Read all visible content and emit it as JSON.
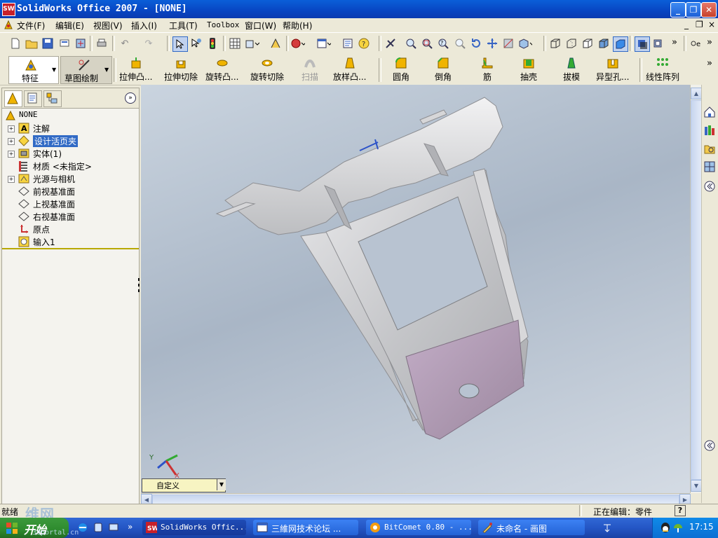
{
  "window": {
    "title": "SolidWorks Office 2007 - [NONE]",
    "app_icon": "SW",
    "min_symbol": "_",
    "max_symbol": "❐",
    "close_symbol": "✕"
  },
  "menubar": {
    "items": [
      "文件(F)",
      "编辑(E)",
      "视图(V)",
      "插入(I)",
      "工具(T)",
      "Toolbox",
      "窗口(W)",
      "帮助(H)"
    ],
    "doc_min": "_",
    "doc_restore": "❐",
    "doc_close": "×"
  },
  "standard_toolbar": {
    "overflow_1": "»",
    "overflow_2": "»"
  },
  "command_manager": {
    "buttons": [
      "特征",
      "草图绘制",
      "拉伸凸...",
      "拉伸切除",
      "旋转凸...",
      "旋转切除",
      "扫描",
      "放样凸...",
      "圆角",
      "倒角",
      "筋",
      "抽壳",
      "拔模",
      "异型孔...",
      "线性阵列"
    ],
    "overflow": "»"
  },
  "feature_tree": {
    "root": "NONE",
    "collapse_symbol": "»",
    "nodes": [
      {
        "label": "注解",
        "icon": "annotations-icon",
        "expandable": true
      },
      {
        "label": "设计活页夹",
        "icon": "design-binder-icon",
        "expandable": true,
        "selected": true
      },
      {
        "label": "实体(1)",
        "icon": "solid-bodies-icon",
        "expandable": true
      },
      {
        "label": "材质 <未指定>",
        "icon": "material-icon",
        "expandable": false
      },
      {
        "label": "光源与相机",
        "icon": "lights-cameras-icon",
        "expandable": true
      },
      {
        "label": "前视基准面",
        "icon": "plane-icon",
        "expandable": false
      },
      {
        "label": "上视基准面",
        "icon": "plane-icon",
        "expandable": false
      },
      {
        "label": "右视基准面",
        "icon": "plane-icon",
        "expandable": false
      },
      {
        "label": "原点",
        "icon": "origin-icon",
        "expandable": false
      },
      {
        "label": "输入1",
        "icon": "imported-body-icon",
        "expandable": false
      }
    ]
  },
  "viewport": {
    "triad_y": "Y",
    "triad_x": "X",
    "view_selector_value": "自定义",
    "view_selector_arrow": "▼"
  },
  "status_bar": {
    "left_text": "就绪",
    "right_text": "正在编辑：零件",
    "help_symbol": "?"
  },
  "taskbar": {
    "start_label": "开始",
    "quicklaunch_more": "»",
    "tasks": [
      {
        "label": "SolidWorks Offic...",
        "icon": "solidworks-icon",
        "active": true
      },
      {
        "label": "三維网技术论坛 ...",
        "icon": "browser-icon",
        "active": false
      },
      {
        "label": "BitComet 0.80 - ...",
        "icon": "bitcomet-icon",
        "active": false
      },
      {
        "label": "未命名 - 画图",
        "icon": "paint-icon",
        "active": false
      }
    ],
    "clock": "17:15"
  },
  "watermark": {
    "text": "3dportal.cn"
  },
  "colors": {
    "titlebar": "#0a5fd8",
    "part_body": "#c8c9cb",
    "part_highlight_face": "#b29cb5",
    "viewport_bg": "#b8c3d1"
  }
}
